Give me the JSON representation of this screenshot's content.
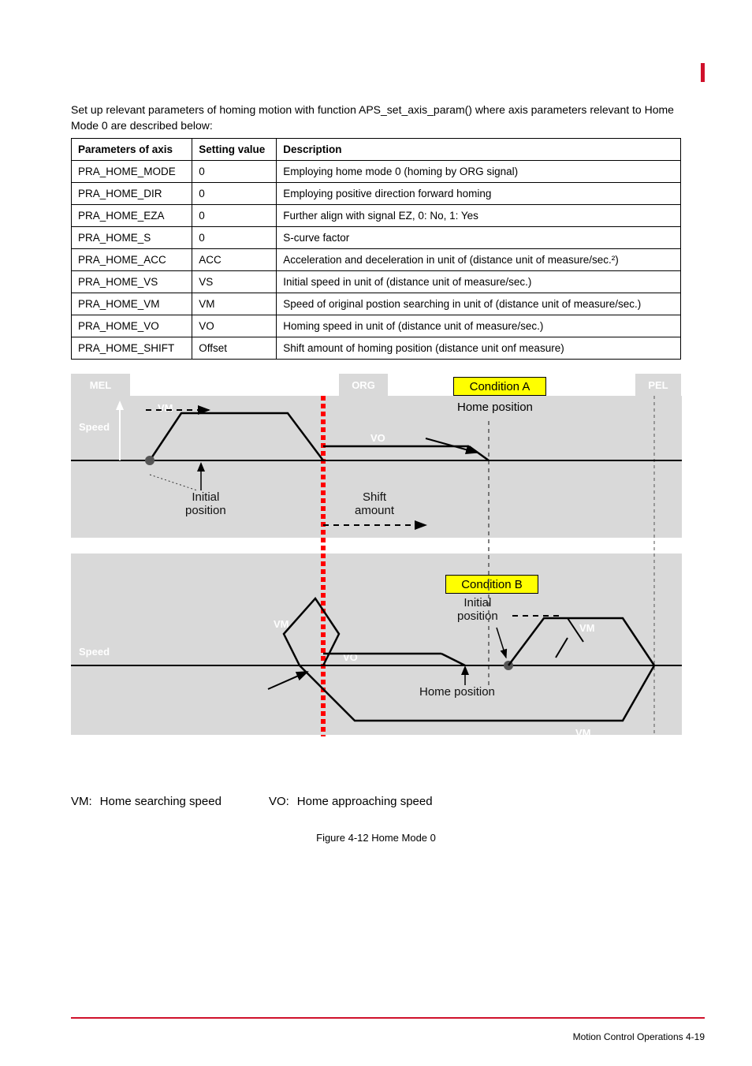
{
  "intro": "Set up relevant parameters of homing motion with function APS_set_axis_param() where axis parameters relevant to Home Mode 0 are described below:",
  "table": {
    "headers": [
      "Parameters of axis",
      "Setting value",
      "Description"
    ],
    "rows": [
      {
        "p": "PRA_HOME_MODE",
        "v": "0",
        "d": "Employing home mode 0 (homing by ORG signal)"
      },
      {
        "p": "PRA_HOME_DIR",
        "v": "0",
        "d": "Employing positive direction forward homing"
      },
      {
        "p": "PRA_HOME_EZA",
        "v": "0",
        "d": "Further align with signal EZ, 0: No, 1: Yes"
      },
      {
        "p": "PRA_HOME_S",
        "v": "0",
        "d": "S-curve factor"
      },
      {
        "p": "PRA_HOME_ACC",
        "v": "ACC",
        "d": "Acceleration and deceleration in unit of (distance unit of measure/sec.²)"
      },
      {
        "p": "PRA_HOME_VS",
        "v": "VS",
        "d": "Initial speed in unit of (distance unit of measure/sec.)"
      },
      {
        "p": "PRA_HOME_VM",
        "v": "VM",
        "d": "Speed of original postion searching in unit of (distance unit of measure/sec.)"
      },
      {
        "p": "PRA_HOME_VO",
        "v": "VO",
        "d": "Homing speed in unit of (distance unit of measure/sec.)"
      },
      {
        "p": "PRA_HOME_SHIFT",
        "v": "Offset",
        "d": "Shift amount of homing position (distance unit onf measure)"
      }
    ]
  },
  "figure": {
    "mel": "MEL",
    "pel": "PEL",
    "org": "ORG",
    "condA": "Condition A",
    "condB": "Condition B",
    "homePos": "Home position",
    "speed": "Speed",
    "vm": "VM",
    "vo": "VO",
    "initial1": "Initial",
    "initial2": "position",
    "shift1": "Shift",
    "shift2": "amount",
    "caption": "Figure 4-12 Home Mode 0"
  },
  "legend": {
    "vm": "Home searching speed",
    "vo": "Home approaching speed"
  },
  "footer": "Motion Control Operations    4-19"
}
